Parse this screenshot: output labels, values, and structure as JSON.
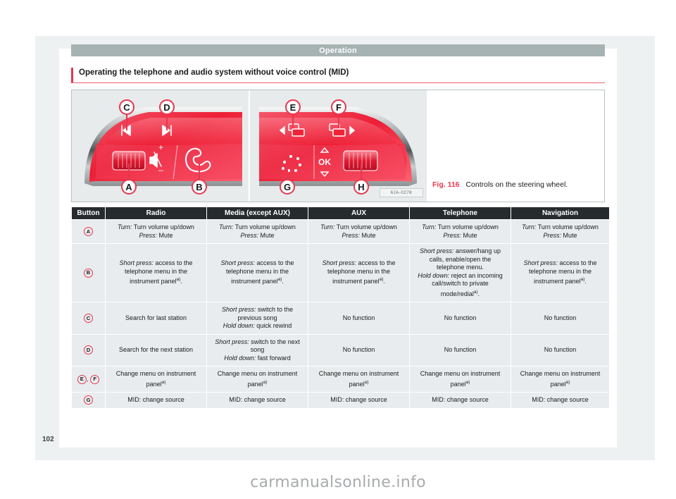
{
  "chapter": {
    "title": "Operation"
  },
  "section": {
    "heading": "Operating the telephone and audio system without voice control (MID)"
  },
  "figure": {
    "number": "Fig. 116",
    "caption": "Controls on the steering wheel.",
    "code": "6JA-0278",
    "callouts_left": [
      "C",
      "D",
      "A",
      "B"
    ],
    "callouts_right": [
      "E",
      "F",
      "G",
      "H"
    ],
    "glyphs": {
      "prev_track": "prev-track-icon",
      "next_track": "next-track-icon",
      "mute": "mute-speaker-icon",
      "plus": "+",
      "minus": "−",
      "phone": "phone-handset-icon",
      "menu_left": "menu-left-icon",
      "menu_right": "menu-right-icon",
      "voice": "voice-circle-icon",
      "ok": "OK",
      "up": "△",
      "down": "▽"
    }
  },
  "table": {
    "headers": [
      "Button",
      "Radio",
      "Media (except AUX)",
      "AUX",
      "Telephone",
      "Navigation"
    ],
    "rows": [
      {
        "button": [
          "A"
        ],
        "cells": [
          {
            "lines": [
              {
                "kw": "Turn:",
                "text": " Turn volume up/down"
              },
              {
                "kw": "Press:",
                "text": " Mute"
              }
            ]
          },
          {
            "lines": [
              {
                "kw": "Turn:",
                "text": " Turn volume up/down"
              },
              {
                "kw": "Press:",
                "text": " Mute"
              }
            ]
          },
          {
            "lines": [
              {
                "kw": "Turn:",
                "text": " Turn volume up/down"
              },
              {
                "kw": "Press:",
                "text": " Mute"
              }
            ]
          },
          {
            "lines": [
              {
                "kw": "Turn:",
                "text": " Turn volume up/down"
              },
              {
                "kw": "Press:",
                "text": " Mute"
              }
            ]
          },
          {
            "lines": [
              {
                "kw": "Turn:",
                "text": " Turn volume up/down"
              },
              {
                "kw": "Press:",
                "text": " Mute"
              }
            ]
          }
        ]
      },
      {
        "button": [
          "B"
        ],
        "cells": [
          {
            "lines": [
              {
                "kw": "Short press:",
                "text": " access to the telephone menu in the instrument panel",
                "sup": "a)",
                "tail": "."
              }
            ]
          },
          {
            "lines": [
              {
                "kw": "Short press:",
                "text": " access to the telephone menu in the instrument panel",
                "sup": "a)",
                "tail": "."
              }
            ]
          },
          {
            "lines": [
              {
                "kw": "Short press:",
                "text": " access to the telephone menu in the instrument panel",
                "sup": "a)",
                "tail": "."
              }
            ]
          },
          {
            "lines": [
              {
                "kw": "Short press:",
                "text": " answer/hang up calls, enable/open the telephone menu."
              },
              {
                "kw": "Hold down:",
                "text": " reject an incoming call/switch to private mode/redial",
                "sup": "a)",
                "tail": "."
              }
            ]
          },
          {
            "lines": [
              {
                "kw": "Short press:",
                "text": " access to the telephone menu in the instrument panel",
                "sup": "a)",
                "tail": "."
              }
            ]
          }
        ]
      },
      {
        "button": [
          "C"
        ],
        "cells": [
          {
            "lines": [
              {
                "kw": "",
                "text": "Search for last station"
              }
            ]
          },
          {
            "lines": [
              {
                "kw": "Short press:",
                "text": " switch to the previous song"
              },
              {
                "kw": "Hold down:",
                "text": " quick rewind"
              }
            ]
          },
          {
            "lines": [
              {
                "kw": "",
                "text": "No function"
              }
            ]
          },
          {
            "lines": [
              {
                "kw": "",
                "text": "No function"
              }
            ]
          },
          {
            "lines": [
              {
                "kw": "",
                "text": "No function"
              }
            ]
          }
        ]
      },
      {
        "button": [
          "D"
        ],
        "cells": [
          {
            "lines": [
              {
                "kw": "",
                "text": "Search for the next station"
              }
            ]
          },
          {
            "lines": [
              {
                "kw": "Short press:",
                "text": " switch to the next song"
              },
              {
                "kw": "Hold down:",
                "text": " fast forward"
              }
            ]
          },
          {
            "lines": [
              {
                "kw": "",
                "text": "No function"
              }
            ]
          },
          {
            "lines": [
              {
                "kw": "",
                "text": "No function"
              }
            ]
          },
          {
            "lines": [
              {
                "kw": "",
                "text": "No function"
              }
            ]
          }
        ]
      },
      {
        "button": [
          "E",
          "F"
        ],
        "cells": [
          {
            "lines": [
              {
                "kw": "",
                "text": "Change menu on instrument panel",
                "sup": "a)"
              }
            ]
          },
          {
            "lines": [
              {
                "kw": "",
                "text": "Change menu on instrument panel",
                "sup": "a)"
              }
            ]
          },
          {
            "lines": [
              {
                "kw": "",
                "text": "Change menu on instrument panel",
                "sup": "a)"
              }
            ]
          },
          {
            "lines": [
              {
                "kw": "",
                "text": "Change menu on instrument panel",
                "sup": "a)"
              }
            ]
          },
          {
            "lines": [
              {
                "kw": "",
                "text": "Change menu on instrument panel",
                "sup": "a)"
              }
            ]
          }
        ]
      },
      {
        "button": [
          "G"
        ],
        "cells": [
          {
            "lines": [
              {
                "kw": "",
                "text": "MID: change source"
              }
            ]
          },
          {
            "lines": [
              {
                "kw": "",
                "text": "MID: change source"
              }
            ]
          },
          {
            "lines": [
              {
                "kw": "",
                "text": "MID: change source"
              }
            ]
          },
          {
            "lines": [
              {
                "kw": "",
                "text": "MID: change source"
              }
            ]
          },
          {
            "lines": [
              {
                "kw": "",
                "text": "MID: change source"
              }
            ]
          }
        ]
      }
    ]
  },
  "footer": {
    "page_number": "102",
    "watermark": "carmanualsonline.info"
  },
  "colors": {
    "accent": "#e8364f",
    "chapter_bar": "#a7b3b3",
    "table_header": "#262b2e",
    "cell_bg": "#e8ecee"
  }
}
